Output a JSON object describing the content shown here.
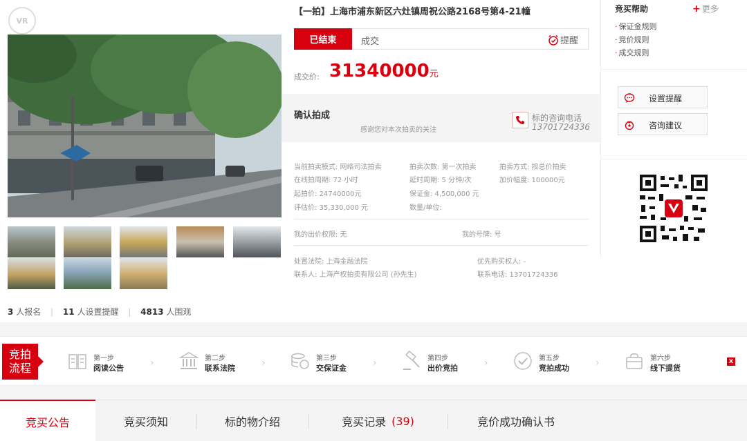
{
  "watermark": "VR",
  "title": "【一拍】上海市浦东新区六灶镇周祝公路2168号第4-21幢",
  "status": {
    "tag": "已结束",
    "text": "成交",
    "remind": "提醒"
  },
  "price": {
    "label": "成交价:",
    "value": "31340000",
    "unit": "元"
  },
  "confirm": {
    "title": "确认拍成",
    "subtitle": "感谢您对本次拍卖的关注",
    "phone_label": "标的咨询电话",
    "phone_number": "13701724336"
  },
  "info": {
    "mode": "当前拍卖模式: 网络司法拍卖",
    "times": "拍卖次数: 第一次拍卖",
    "method": "拍卖方式: 按总价拍卖",
    "online_cycle": "在线拍周期: 72 小时",
    "delay_cycle": "延时周期: 5 分钟/次",
    "increment": "加价幅度: 100000元",
    "start_price": "起拍价: 24740000元",
    "deposit": "保证金: 4,500,000 元",
    "appraisal": "评估价: 35,330,000 元",
    "quantity": "数量/单位:",
    "my_right": "我的出价权限: 无",
    "my_number": "我的号牌: 号",
    "court": "处置法院: 上海金融法院",
    "priority": "优先购买权人: -",
    "contact": "联系人: 上海产权拍卖有限公司 (孙先生)",
    "contact_phone": "联系电话: 13701724336"
  },
  "help": {
    "title": "竞买帮助",
    "more": "更多",
    "links": [
      "保证金规则",
      "竞价规则",
      "成交规则"
    ]
  },
  "actions": {
    "set_remind": "设置提醒",
    "advice": "咨询建议"
  },
  "stats": {
    "registered": "3",
    "registered_label": "人报名",
    "reminders": "11",
    "reminders_label": "人设置提醒",
    "watchers": "4813",
    "watchers_label": "人围观"
  },
  "flow": {
    "badge": "竞拍\n流程",
    "steps": [
      {
        "label": "第一步",
        "name": "阅读公告"
      },
      {
        "label": "第二步",
        "name": "联系法院"
      },
      {
        "label": "第三步",
        "name": "交保证金"
      },
      {
        "label": "第四步",
        "name": "出价竞拍"
      },
      {
        "label": "第五步",
        "name": "竞拍成功"
      },
      {
        "label": "第六步",
        "name": "线下提货"
      }
    ],
    "close": "x"
  },
  "tabs": [
    {
      "label": "竞买公告"
    },
    {
      "label": "竞买须知"
    },
    {
      "label": "标的物介绍"
    },
    {
      "label": "竞买记录",
      "count": "(39)"
    },
    {
      "label": "竞价成功确认书"
    }
  ],
  "colors": {
    "accent": "#d7000f",
    "muted": "#999999"
  }
}
